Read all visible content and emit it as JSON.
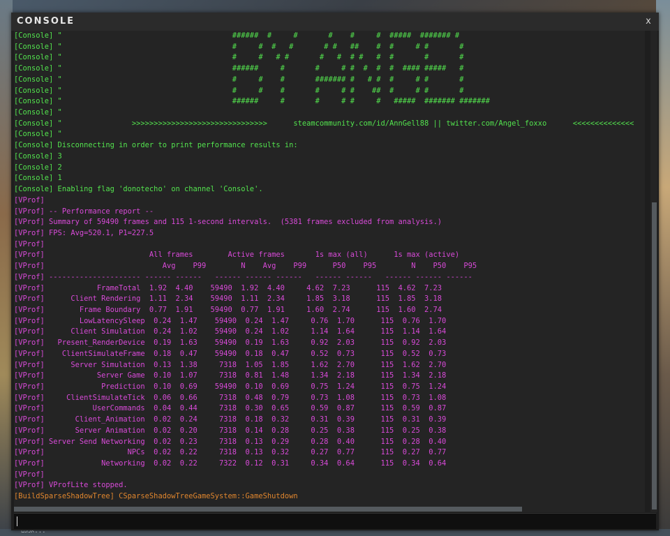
{
  "window": {
    "title": "CONSOLE",
    "close_label": "x"
  },
  "background": {
    "bottom_text": "אמנם..."
  },
  "input": {
    "value": "",
    "placeholder": ""
  },
  "lines": [
    {
      "cls": "green",
      "text": "[Console] \"                                       ######  #     #       #    #     #  #####  ####### #"
    },
    {
      "cls": "green",
      "text": "[Console] \"                                       #     #  #   #       # #   ##    #  #     # #       #"
    },
    {
      "cls": "green",
      "text": "[Console] \"                                       #     #   # #       #   #  # #   #  #       #       #"
    },
    {
      "cls": "green",
      "text": "[Console] \"                                       ######     #       #     # #  #  #  #  #### #####   #"
    },
    {
      "cls": "green",
      "text": "[Console] \"                                       #     #    #       ####### #   # #  #     # #       #"
    },
    {
      "cls": "green",
      "text": "[Console] \"                                       #     #    #       #     # #    ##  #     # #       #"
    },
    {
      "cls": "green",
      "text": "[Console] \"                                       ######     #       #     # #     #   #####  ####### #######"
    },
    {
      "cls": "green",
      "text": "[Console] \""
    },
    {
      "cls": "green",
      "text": "[Console] \"                >>>>>>>>>>>>>>>>>>>>>>>>>>>>>>>      steamcommunity.com/id/AnnGell88 || twitter.com/Angel_foxxo      <<<<<<<<<<<<<<"
    },
    {
      "cls": "green",
      "text": "[Console] \""
    },
    {
      "cls": "green",
      "text": "[Console] Disconnecting in order to print performance results in:"
    },
    {
      "cls": "green",
      "text": "[Console] 3"
    },
    {
      "cls": "green",
      "text": "[Console] 2"
    },
    {
      "cls": "green",
      "text": "[Console] 1"
    },
    {
      "cls": "green",
      "text": "[Console] Enabling flag 'donotecho' on channel 'Console'."
    },
    {
      "cls": "magenta",
      "text": "[VProf]"
    },
    {
      "cls": "magenta",
      "text": "[VProf] -- Performance report --"
    },
    {
      "cls": "magenta",
      "text": "[VProf] Summary of 59490 frames and 115 1-second intervals.  (5381 frames excluded from analysis.)"
    },
    {
      "cls": "magenta",
      "text": "[VProf] FPS: Avg=520.1, P1=227.5"
    },
    {
      "cls": "magenta",
      "text": "[VProf]"
    },
    {
      "cls": "magenta",
      "text": "[VProf]                        All frames        Active frames       1s max (all)      1s max (active)"
    },
    {
      "cls": "magenta",
      "text": "[VProf]                           Avg    P99        N    Avg    P99      P50    P95        N    P50    P95"
    },
    {
      "cls": "magenta",
      "text": "[VProf] --------------------- ------ ------   ------ ------ ------   ------ ------   ------ ------ ------"
    },
    {
      "cls": "magenta",
      "text": "[VProf]            FrameTotal  1.92  4.40    59490  1.92  4.40     4.62  7.23      115  4.62  7.23"
    },
    {
      "cls": "magenta",
      "text": "[VProf]      Client Rendering  1.11  2.34    59490  1.11  2.34     1.85  3.18      115  1.85  3.18"
    },
    {
      "cls": "magenta",
      "text": "[VProf]        Frame Boundary  0.77  1.91    59490  0.77  1.91     1.60  2.74      115  1.60  2.74"
    },
    {
      "cls": "magenta",
      "text": "[VProf]        LowLatencySleep  0.24  1.47    59490  0.24  1.47     0.76  1.70      115  0.76  1.70"
    },
    {
      "cls": "magenta",
      "text": "[VProf]      Client Simulation  0.24  1.02    59490  0.24  1.02     1.14  1.64      115  1.14  1.64"
    },
    {
      "cls": "magenta",
      "text": "[VProf]   Present_RenderDevice  0.19  1.63    59490  0.19  1.63     0.92  2.03      115  0.92  2.03"
    },
    {
      "cls": "magenta",
      "text": "[VProf]    ClientSimulateFrame  0.18  0.47    59490  0.18  0.47     0.52  0.73      115  0.52  0.73"
    },
    {
      "cls": "magenta",
      "text": "[VProf]      Server Simulation  0.13  1.38     7318  1.05  1.85     1.62  2.70      115  1.62  2.70"
    },
    {
      "cls": "magenta",
      "text": "[VProf]            Server Game  0.10  1.07     7318  0.81  1.48     1.34  2.18      115  1.34  2.18"
    },
    {
      "cls": "magenta",
      "text": "[VProf]             Prediction  0.10  0.69    59490  0.10  0.69     0.75  1.24      115  0.75  1.24"
    },
    {
      "cls": "magenta",
      "text": "[VProf]     ClientSimulateTick  0.06  0.66     7318  0.48  0.79     0.73  1.08      115  0.73  1.08"
    },
    {
      "cls": "magenta",
      "text": "[VProf]           UserCommands  0.04  0.44     7318  0.30  0.65     0.59  0.87      115  0.59  0.87"
    },
    {
      "cls": "magenta",
      "text": "[VProf]       Client_Animation  0.02  0.24     7318  0.18  0.32     0.31  0.39      115  0.31  0.39"
    },
    {
      "cls": "magenta",
      "text": "[VProf]       Server Animation  0.02  0.20     7318  0.14  0.28     0.25  0.38      115  0.25  0.38"
    },
    {
      "cls": "magenta",
      "text": "[VProf] Server Send Networking  0.02  0.23     7318  0.13  0.29     0.28  0.40      115  0.28  0.40"
    },
    {
      "cls": "magenta",
      "text": "[VProf]                   NPCs  0.02  0.22     7318  0.13  0.32     0.27  0.77      115  0.27  0.77"
    },
    {
      "cls": "magenta",
      "text": "[VProf]             Networking  0.02  0.22     7322  0.12  0.31     0.34  0.64      115  0.34  0.64"
    },
    {
      "cls": "magenta",
      "text": "[VProf]"
    },
    {
      "cls": "magenta",
      "text": "[VProf] VProfLite stopped."
    },
    {
      "cls": "orange",
      "text": "[BuildSparseShadowTree] CSparseShadowTreeGameSystem::GameShutdown"
    }
  ]
}
